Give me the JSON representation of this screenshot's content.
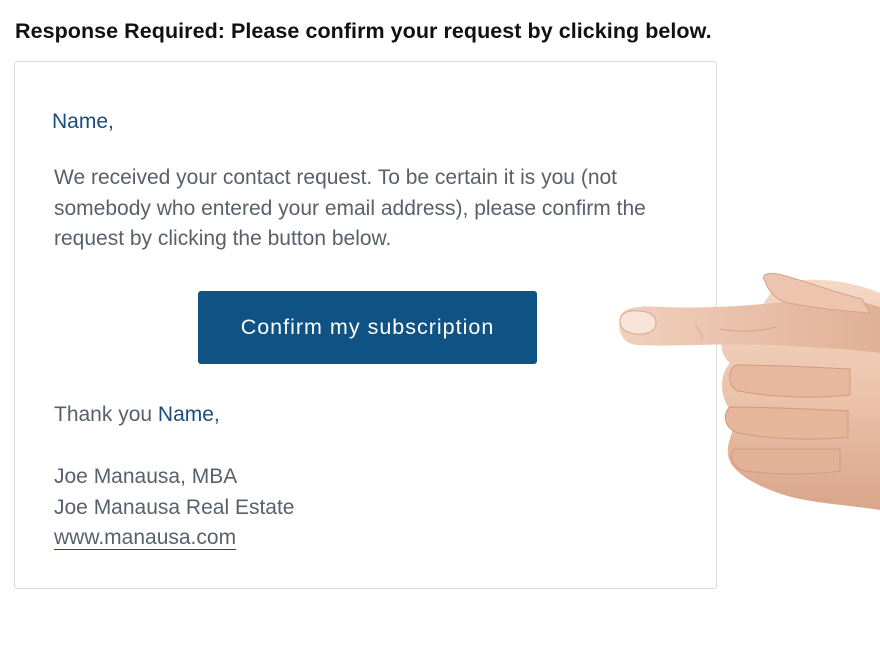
{
  "email": {
    "headline": "Response Required: Please confirm your request by clicking below.",
    "greeting": "Name,",
    "body": "We received your contact request. To be certain it is you (not somebody who entered your email address), please confirm the request by clicking the button below.",
    "confirm_button_label": "Confirm my subscription",
    "thanks_prefix": "Thank you ",
    "thanks_name": "Name,",
    "signature": {
      "name": "Joe Manausa, MBA",
      "company": "Joe Manausa Real Estate",
      "website": "www.manausa.com"
    }
  },
  "colors": {
    "button_bg": "#0f5384",
    "accent_text": "#1a4d7a",
    "body_text": "#58616b",
    "card_border": "#dcdcdc"
  },
  "decor": {
    "hand_icon": "pointing-hand-icon"
  }
}
